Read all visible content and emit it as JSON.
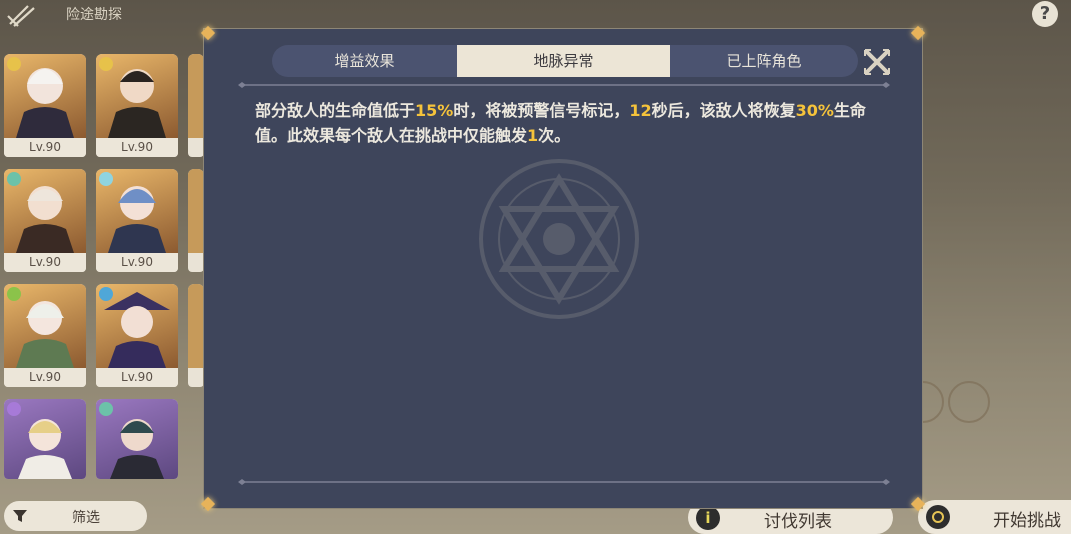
{
  "header": {
    "title": "险途勘探"
  },
  "colors": {
    "highlight": "#f5c33b",
    "modal_bg": "#3e455b",
    "tab_active_bg": "#ece5d6"
  },
  "characters": [
    {
      "level": "Lv.90",
      "element": "geo"
    },
    {
      "level": "Lv.90",
      "element": "geo"
    },
    {
      "level": "Lv.90",
      "element": "anemo"
    },
    {
      "level": "Lv.90",
      "element": "cryo"
    },
    {
      "level": "Lv.90",
      "element": "dendro"
    },
    {
      "level": "Lv.90",
      "element": "hydro"
    },
    {
      "level": "",
      "element": "electro"
    },
    {
      "level": "",
      "element": "anemo"
    }
  ],
  "modal": {
    "tabs": [
      "增益效果",
      "地脉异常",
      "已上阵角色"
    ],
    "active_tab": 1,
    "description": {
      "t1": "部分敌人的生命值低于",
      "v1": "15%",
      "t2": "时，将被预警信号标记，",
      "v2": "12",
      "t3": "秒后，该敌人将恢复",
      "v3": "30%",
      "t4": "生命值。此效果每个敌人在挑战中仅能触发",
      "v4": "1",
      "t5": "次。"
    }
  },
  "bottom": {
    "filter_label": "筛选",
    "list_label": "讨伐列表",
    "start_label": "开始挑战"
  }
}
